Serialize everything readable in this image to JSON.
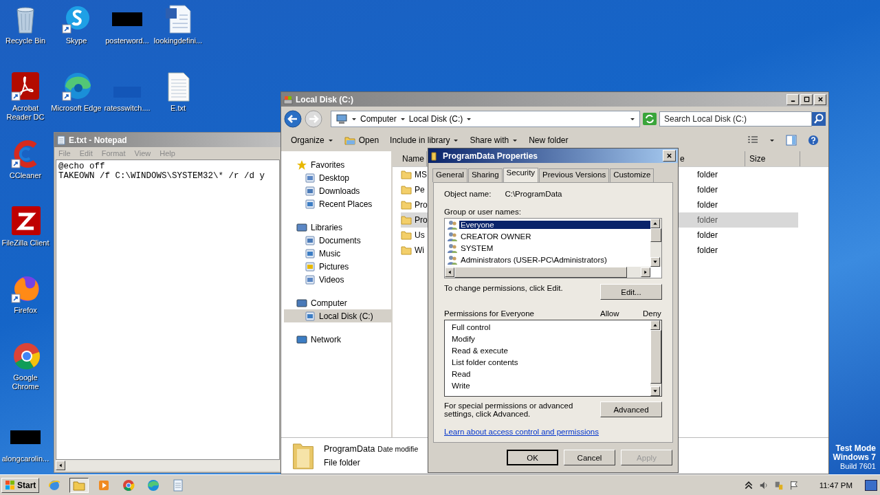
{
  "desktop_icons": [
    {
      "label": "Recycle Bin",
      "shortcut": false
    },
    {
      "label": "Skype",
      "shortcut": true
    },
    {
      "label": "posterword...",
      "shortcut": false
    },
    {
      "label": "lookingdefini...",
      "shortcut": false
    },
    {
      "label": "Acrobat Reader DC",
      "shortcut": true
    },
    {
      "label": "Microsoft Edge",
      "shortcut": true
    },
    {
      "label": "ratesswitch....",
      "shortcut": false
    },
    {
      "label": "E.txt",
      "shortcut": false
    },
    {
      "label": "CCleaner",
      "shortcut": true
    },
    {
      "label": "FileZilla Client",
      "shortcut": false
    },
    {
      "label": "Firefox",
      "shortcut": true
    },
    {
      "label": "Google Chrome",
      "shortcut": false
    },
    {
      "label": "alongcarolin...",
      "shortcut": false
    }
  ],
  "notepad": {
    "title": "E.txt - Notepad",
    "menu": [
      "File",
      "Edit",
      "Format",
      "View",
      "Help"
    ],
    "lines": [
      "@echo off",
      "TAKEOWN /f C:\\WINDOWS\\SYSTEM32\\* /r /d y"
    ]
  },
  "explorer": {
    "title": "Local Disk (C:)",
    "breadcrumb": [
      "Computer",
      "Local Disk (C:)"
    ],
    "search": {
      "placeholder": "Search Local Disk (C:)"
    },
    "toolbar": [
      {
        "label": "Organize",
        "kind": "dropdown"
      },
      {
        "label": "Open",
        "kind": "icon"
      },
      {
        "label": "Include in library",
        "kind": "dropdown"
      },
      {
        "label": "Share with",
        "kind": "dropdown"
      },
      {
        "label": "New folder",
        "kind": "plain"
      }
    ],
    "nav": [
      {
        "label": "Favorites",
        "children": [
          {
            "label": "Desktop",
            "selected": false
          },
          {
            "label": "Downloads",
            "selected": false
          },
          {
            "label": "Recent Places",
            "selected": false
          }
        ]
      },
      {
        "label": "Libraries",
        "children": [
          {
            "label": "Documents",
            "selected": false
          },
          {
            "label": "Music",
            "selected": false
          },
          {
            "label": "Pictures",
            "selected": false
          },
          {
            "label": "Videos",
            "selected": false
          }
        ]
      },
      {
        "label": "Computer",
        "children": [
          {
            "label": "Local Disk (C:)",
            "selected": true
          }
        ]
      },
      {
        "label": "Network"
      }
    ],
    "columns": [
      "Name",
      "e",
      "Size"
    ],
    "rows": [
      {
        "name": "MS",
        "type": "folder",
        "selected": false
      },
      {
        "name": "Pe",
        "type": "folder",
        "selected": false
      },
      {
        "name": "Pro",
        "type": "folder",
        "selected": false
      },
      {
        "name": "Pro",
        "type": "folder",
        "selected": true
      },
      {
        "name": "Us",
        "type": "folder",
        "selected": false
      },
      {
        "name": "Wi",
        "type": "folder",
        "selected": false
      }
    ],
    "details": {
      "name": "ProgramData",
      "date_label": "Date modifie",
      "type": "File folder"
    }
  },
  "dialog": {
    "title": "ProgramData Properties",
    "tabs": [
      {
        "label": "General",
        "selected": false
      },
      {
        "label": "Sharing",
        "selected": false
      },
      {
        "label": "Security",
        "selected": true
      },
      {
        "label": "Previous Versions",
        "selected": false
      },
      {
        "label": "Customize",
        "selected": false
      }
    ],
    "object_label": "Object name:",
    "object_value": "C:\\ProgramData",
    "group_label": "Group or user names:",
    "users": [
      {
        "label": "Everyone",
        "selected": true
      },
      {
        "label": "CREATOR OWNER",
        "selected": false
      },
      {
        "label": "SYSTEM",
        "selected": false
      },
      {
        "label": "Administrators (USER-PC\\Administrators)",
        "selected": false
      }
    ],
    "change_text": "To change permissions, click Edit.",
    "edit_button": "Edit...",
    "permissions_label": "Permissions for Everyone",
    "allow": "Allow",
    "deny": "Deny",
    "permissions": [
      "Full control",
      "Modify",
      "Read & execute",
      "List folder contents",
      "Read",
      "Write"
    ],
    "advanced_text": "For special permissions or advanced settings, click Advanced.",
    "advanced_button": "Advanced",
    "link": "Learn about access control and permissions",
    "buttons": [
      {
        "label": "OK",
        "disabled": false
      },
      {
        "label": "Cancel",
        "disabled": false
      },
      {
        "label": "Apply",
        "disabled": true
      }
    ]
  },
  "taskbar": {
    "start": "Start",
    "items": [
      {
        "selected": false
      },
      {
        "selected": true
      },
      {
        "selected": false
      },
      {
        "selected": false
      },
      {
        "selected": false
      },
      {
        "selected": false
      }
    ],
    "time": "11:47 PM"
  },
  "watermark_os": [
    "Test Mode",
    "Windows 7",
    "Build 7601"
  ]
}
